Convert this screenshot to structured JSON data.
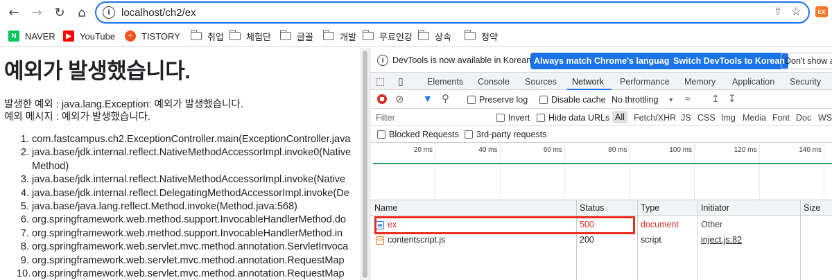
{
  "browser": {
    "url": "localhost/ch2/ex",
    "ext_badge": "EX"
  },
  "bookmarks": [
    {
      "label": "NAVER",
      "icon": "naver-icon",
      "color": "#03c75a",
      "glyph": "N"
    },
    {
      "label": "YouTube",
      "icon": "youtube-icon",
      "color": "#ff0000",
      "glyph": "▶"
    },
    {
      "label": "TISTORY",
      "icon": "tistory-icon",
      "color": "#eb531f",
      "glyph": "⁘"
    },
    {
      "label": "취업",
      "icon": "folder-icon"
    },
    {
      "label": "체험단",
      "icon": "folder-icon"
    },
    {
      "label": "글꼴",
      "icon": "folder-icon"
    },
    {
      "label": "개발",
      "icon": "folder-icon"
    },
    {
      "label": "무료인강",
      "icon": "folder-icon"
    },
    {
      "label": "상속",
      "icon": "folder-icon"
    },
    {
      "label": "청약",
      "icon": "folder-icon"
    }
  ],
  "page": {
    "heading": "예외가 발생했습니다.",
    "line1": "발생한 예외 : java.lang.Exception: 예외가 발생했습니다.",
    "line2": "예외 메시지 : 예외가 발생했습니다.",
    "stack": [
      {
        "n": "1.",
        "l1": "com.fastcampus.ch2.ExceptionController.main(ExceptionController.java",
        "l2": ""
      },
      {
        "n": "2.",
        "l1": "java.base/jdk.internal.reflect.NativeMethodAccessorImpl.invoke0(Native",
        "l2": "Method)"
      },
      {
        "n": "3.",
        "l1": "java.base/jdk.internal.reflect.NativeMethodAccessorImpl.invoke(Native",
        "l2": ""
      },
      {
        "n": "4.",
        "l1": "java.base/jdk.internal.reflect.DelegatingMethodAccessorImpl.invoke(De",
        "l2": ""
      },
      {
        "n": "5.",
        "l1": "java.base/java.lang.reflect.Method.invoke(Method.java:568)",
        "l2": ""
      },
      {
        "n": "6.",
        "l1": "org.springframework.web.method.support.InvocableHandlerMethod.do",
        "l2": ""
      },
      {
        "n": "7.",
        "l1": "org.springframework.web.method.support.InvocableHandlerMethod.in",
        "l2": ""
      },
      {
        "n": "8.",
        "l1": "org.springframework.web.servlet.mvc.method.annotation.ServletInvoca",
        "l2": ""
      },
      {
        "n": "9.",
        "l1": "org.springframework.web.servlet.mvc.method.annotation.RequestMap",
        "l2": ""
      },
      {
        "n": "10.",
        "l1": "org.springframework.web.servlet.mvc.method.annotation.RequestMap",
        "l2": ""
      }
    ]
  },
  "devtools": {
    "notice": "DevTools is now available in Korean!",
    "btn_match": "Always match Chrome's language",
    "btn_switch": "Switch DevTools to Korean",
    "btn_dont": "Don't show a",
    "tabs": [
      "Elements",
      "Console",
      "Sources",
      "Network",
      "Performance",
      "Memory",
      "Application",
      "Security"
    ],
    "active_tab": "Network",
    "preserve_log": "Preserve log",
    "disable_cache": "Disable cache",
    "throttling": "No throttling",
    "filter_placeholder": "Filter",
    "invert": "Invert",
    "hide_data_urls": "Hide data URLs",
    "type_filters": [
      "All",
      "Fetch/XHR",
      "JS",
      "CSS",
      "Img",
      "Media",
      "Font",
      "Doc",
      "WS"
    ],
    "blocked_requests": "Blocked Requests",
    "third_party": "3rd-party requests",
    "timeline_ticks": [
      "20 ms",
      "40 ms",
      "60 ms",
      "80 ms",
      "100 ms",
      "120 ms",
      "140 ms"
    ],
    "columns": [
      "Name",
      "Status",
      "Type",
      "Initiator",
      "Size"
    ],
    "rows": [
      {
        "name": "ex",
        "status": "500",
        "type": "document",
        "initiator": "Other",
        "error": true
      },
      {
        "name": "contentscript.js",
        "status": "200",
        "type": "script",
        "initiator": "inject.js:82",
        "error": false
      }
    ]
  }
}
